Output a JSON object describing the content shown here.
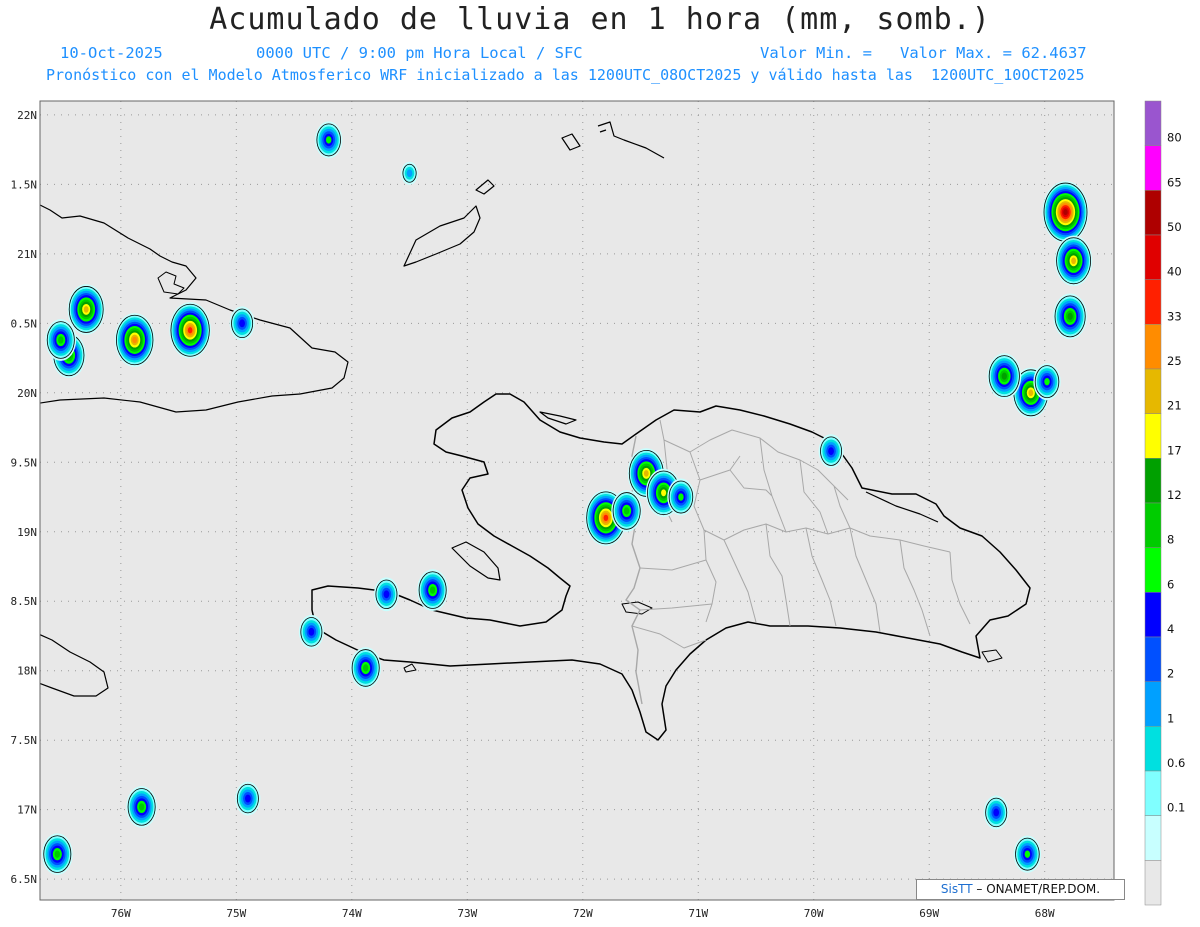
{
  "header": {
    "title": "Acumulado de lluvia en 1 hora (mm, somb.)",
    "date": "10-Oct-2025",
    "time": "0000 UTC / 9:00 pm Hora Local / SFC",
    "min_label": "Valor Min. =",
    "max_label": "Valor Max. = 62.4637",
    "subtitle": "Pronóstico con el Modelo Atmosferico WRF inicializado a las 1200UTC_08OCT2025 y válido hasta las  1200UTC_10OCT2025"
  },
  "map": {
    "lon_range": [
      -76.7,
      -67.4
    ],
    "lat_range": [
      16.35,
      22.1
    ],
    "lon_ticks": [
      {
        "value": -76,
        "label": "76W"
      },
      {
        "value": -75,
        "label": "75W"
      },
      {
        "value": -74,
        "label": "74W"
      },
      {
        "value": -73,
        "label": "73W"
      },
      {
        "value": -72,
        "label": "72W"
      },
      {
        "value": -71,
        "label": "71W"
      },
      {
        "value": -70,
        "label": "70W"
      },
      {
        "value": -69,
        "label": "69W"
      },
      {
        "value": -68,
        "label": "68W"
      }
    ],
    "lat_ticks": [
      {
        "value": 22,
        "label": "22N"
      },
      {
        "value": 21.5,
        "label": "1.5N"
      },
      {
        "value": 21,
        "label": "21N"
      },
      {
        "value": 20.5,
        "label": "0.5N"
      },
      {
        "value": 20,
        "label": "20N"
      },
      {
        "value": 19.5,
        "label": "9.5N"
      },
      {
        "value": 19,
        "label": "19N"
      },
      {
        "value": 18.5,
        "label": "8.5N"
      },
      {
        "value": 18,
        "label": "18N"
      },
      {
        "value": 17.5,
        "label": "7.5N"
      },
      {
        "value": 17,
        "label": "17N"
      },
      {
        "value": 16.5,
        "label": "6.5N"
      }
    ],
    "rain_cells": [
      {
        "lon": -76.45,
        "lat": 20.27,
        "peak": 17
      },
      {
        "lon": -76.3,
        "lat": 20.6,
        "peak": 25
      },
      {
        "lon": -76.52,
        "lat": 20.38,
        "peak": 12
      },
      {
        "lon": -75.88,
        "lat": 20.38,
        "peak": 33
      },
      {
        "lon": -75.4,
        "lat": 20.45,
        "peak": 40
      },
      {
        "lon": -74.2,
        "lat": 21.82,
        "peak": 8
      },
      {
        "lon": -74.95,
        "lat": 20.5,
        "peak": 6
      },
      {
        "lon": -71.8,
        "lat": 19.1,
        "peak": 40
      },
      {
        "lon": -71.62,
        "lat": 19.15,
        "peak": 12
      },
      {
        "lon": -71.45,
        "lat": 19.42,
        "peak": 25
      },
      {
        "lon": -71.3,
        "lat": 19.28,
        "peak": 21
      },
      {
        "lon": -71.15,
        "lat": 19.25,
        "peak": 8
      },
      {
        "lon": -69.85,
        "lat": 19.58,
        "peak": 6
      },
      {
        "lon": -73.3,
        "lat": 18.58,
        "peak": 12
      },
      {
        "lon": -73.88,
        "lat": 18.02,
        "peak": 12
      },
      {
        "lon": -74.35,
        "lat": 18.28,
        "peak": 6
      },
      {
        "lon": -73.7,
        "lat": 18.55,
        "peak": 6
      },
      {
        "lon": -67.82,
        "lat": 21.3,
        "peak": 65
      },
      {
        "lon": -67.75,
        "lat": 20.95,
        "peak": 25
      },
      {
        "lon": -67.78,
        "lat": 20.55,
        "peak": 17
      },
      {
        "lon": -68.12,
        "lat": 20.0,
        "peak": 25
      },
      {
        "lon": -68.35,
        "lat": 20.12,
        "peak": 17
      },
      {
        "lon": -67.98,
        "lat": 20.08,
        "peak": 8
      },
      {
        "lon": -75.82,
        "lat": 17.02,
        "peak": 12
      },
      {
        "lon": -76.55,
        "lat": 16.68,
        "peak": 12
      },
      {
        "lon": -74.9,
        "lat": 17.08,
        "peak": 6
      },
      {
        "lon": -68.15,
        "lat": 16.68,
        "peak": 8
      },
      {
        "lon": -68.42,
        "lat": 16.98,
        "peak": 6
      },
      {
        "lon": -73.5,
        "lat": 21.58,
        "peak": 2
      }
    ]
  },
  "colorbar": {
    "levels": [
      "80",
      "65",
      "50",
      "40",
      "33",
      "25",
      "21",
      "17",
      "12",
      "8",
      "6",
      "4",
      "2",
      "1",
      "0.6",
      "0.1"
    ],
    "colors": [
      "#9a55cf",
      "#ff00ff",
      "#ae0000",
      "#e00000",
      "#ff2000",
      "#ff8c00",
      "#e6b800",
      "#ffff00",
      "#00a000",
      "#00cc00",
      "#00ff00",
      "#0000ff",
      "#0050ff",
      "#00a0ff",
      "#00e0e0",
      "#80ffff",
      "#c8ffff",
      "#e8e8e8"
    ]
  },
  "credit": {
    "logo": "SisTT",
    "text": "– ONAMET/REP.DOM."
  },
  "colors": {
    "ocean": "#e8e8e8",
    "coast": "#000000",
    "provinces": "#a8a8a8"
  }
}
